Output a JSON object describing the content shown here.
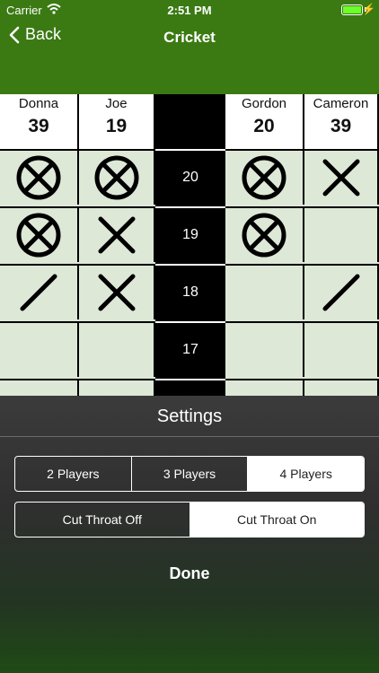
{
  "status_bar": {
    "carrier": "Carrier",
    "time": "2:51 PM"
  },
  "nav": {
    "back_label": "Back",
    "title": "Cricket"
  },
  "players": [
    {
      "name": "Donna",
      "score": "39"
    },
    {
      "name": "Joe",
      "score": "19"
    },
    {
      "name": "Gordon",
      "score": "20"
    },
    {
      "name": "Cameron",
      "score": "39"
    }
  ],
  "rows": [
    {
      "number": "20",
      "marks": [
        "closed",
        "closed",
        "closed",
        "double"
      ]
    },
    {
      "number": "19",
      "marks": [
        "closed",
        "double",
        "closed",
        "none"
      ]
    },
    {
      "number": "18",
      "marks": [
        "single",
        "double",
        "none",
        "single"
      ]
    },
    {
      "number": "17",
      "marks": [
        "none",
        "none",
        "none",
        "none"
      ]
    }
  ],
  "settings": {
    "title": "Settings",
    "player_options": [
      "2 Players",
      "3 Players",
      "4 Players"
    ],
    "player_selected": 2,
    "cutthroat_options": [
      "Cut Throat Off",
      "Cut Throat On"
    ],
    "cutthroat_selected": 1,
    "done_label": "Done"
  },
  "colors": {
    "nav_green": "#3b7a13",
    "cell_green": "#dde8d7",
    "mark": "#000000"
  }
}
